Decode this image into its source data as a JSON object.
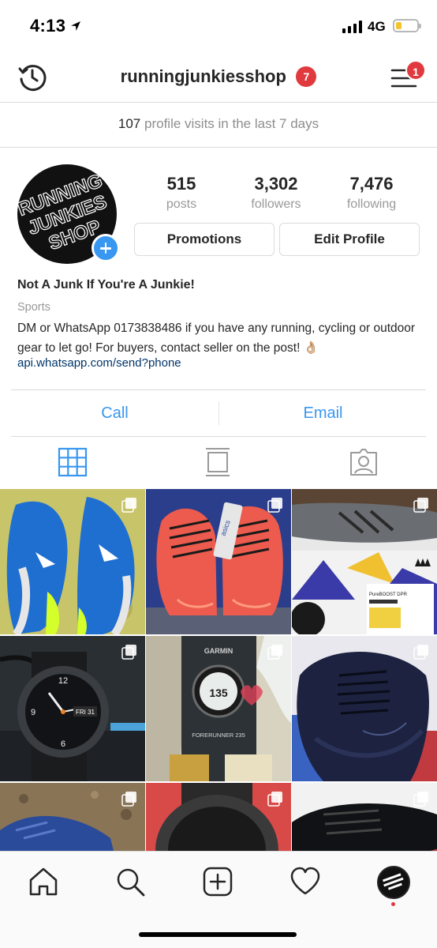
{
  "status_bar": {
    "time": "4:13",
    "network": "4G",
    "battery_level": 0.25
  },
  "header": {
    "username": "runningjunkiesshop",
    "notification_count": "7",
    "menu_badge_count": "1"
  },
  "visits_banner": {
    "count": "107",
    "text": "profile visits in the last 7 days"
  },
  "profile": {
    "avatar_text": [
      "RUNNING",
      "JUNKIES",
      "SHOP"
    ],
    "stats": [
      {
        "value": "515",
        "label": "posts"
      },
      {
        "value": "3,302",
        "label": "followers"
      },
      {
        "value": "7,476",
        "label": "following"
      }
    ],
    "buttons": {
      "promotions": "Promotions",
      "edit_profile": "Edit Profile"
    },
    "bio": {
      "name": "Not A Junk If You're A Junkie!",
      "category": "Sports",
      "text": "DM or WhatsApp 0173838486 if you have any running, cycling or outdoor gear to let go! For buyers, contact seller on the post! 👌🏼",
      "link": "api.whatsapp.com/send?phone"
    }
  },
  "contact": {
    "call": "Call",
    "email": "Email"
  },
  "tabs": [
    {
      "name": "grid-view-tab",
      "icon": "grid-icon",
      "active": true
    },
    {
      "name": "feed-view-tab",
      "icon": "feed-icon",
      "active": false
    },
    {
      "name": "tagged-tab",
      "icon": "tagged-person-icon",
      "active": false
    }
  ],
  "grid_posts": [
    {
      "subject": "blue nike running shoes",
      "multi": true
    },
    {
      "subject": "coral asics running shoes",
      "multi": true
    },
    {
      "subject": "grey adidas pureboost dpr",
      "multi": true
    },
    {
      "subject": "garmin fenix watch",
      "multi": true
    },
    {
      "subject": "garmin forerunner 235 box",
      "multi": true
    },
    {
      "subject": "navy asics running shoes",
      "multi": true
    },
    {
      "subject": "blue shoes on gravel",
      "multi": true
    },
    {
      "subject": "watch on red cloth",
      "multi": true
    },
    {
      "subject": "black running shoes",
      "multi": true
    }
  ],
  "product_text": {
    "garmin_brand": "GARMIN",
    "forerunner": "FORERUNNER 235",
    "watch_reading": "135",
    "fenix_date": "FRI 31",
    "adidas_box": "PureBOOST DPR",
    "asics_tag": "asics"
  },
  "bottom_nav": [
    "home-icon",
    "search-icon",
    "new-post-icon",
    "activity-heart-icon",
    "profile-avatar"
  ],
  "colors": {
    "accent_blue": "#3897f0",
    "badge_red": "#e0393e",
    "muted_text": "#999999",
    "link_blue": "#003569"
  }
}
